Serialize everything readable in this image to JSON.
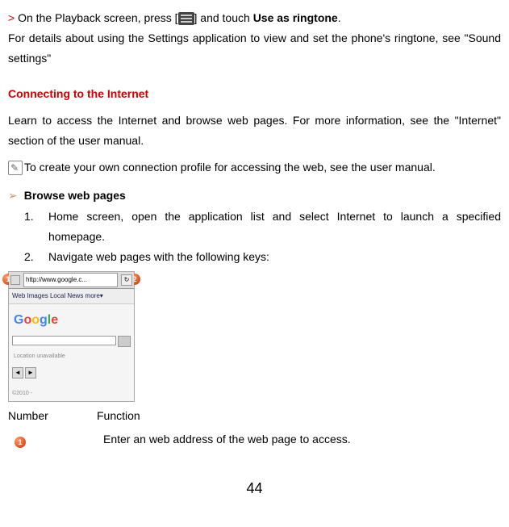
{
  "line1_prefix": "> ",
  "line1_text1": "On the Playback screen, press [",
  "line1_text2": "] and touch ",
  "line1_bold": "Use as ringtone",
  "line1_end": ".",
  "line2": "For details about using the Settings application to view and set the phone's ringtone, see \"Sound settings\"",
  "heading1": "Connecting to the Internet",
  "para1": "Learn to access the Internet and browse web pages. For more information, see the \"Internet\" section of the user manual.",
  "note1": "To create your own connection profile for accessing the web, see the user manual.",
  "subheading1": "Browse web pages",
  "step1": "Home screen, open the application list and select Internet to launch a specified homepage.",
  "step2": "Navigate web pages with the following keys:",
  "url_text": "http://www.google.c...",
  "tabs_text": "Web  Images  Local  News  more▾",
  "unavail": "Location unavailable",
  "copyright": "©2010 -",
  "table_header_num": "Number",
  "table_header_func": "Function",
  "func1": "Enter an web address of the web page to access.",
  "page_number": "44"
}
